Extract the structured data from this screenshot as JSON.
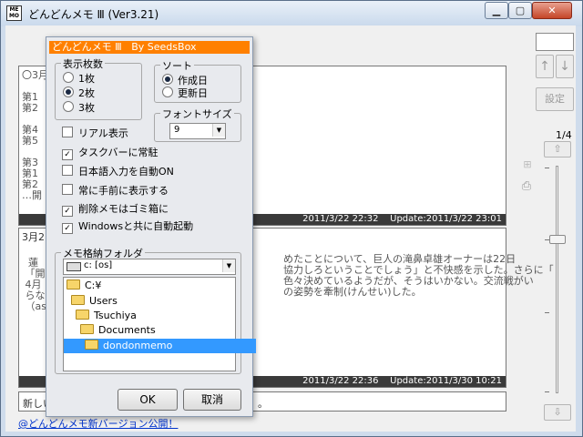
{
  "window": {
    "title": "どんどんメモ Ⅲ (Ver3.21)",
    "icon_text": "ME MO",
    "min_glyph": "▁",
    "max_glyph": "▢",
    "close_glyph": "✕"
  },
  "sidebar": {
    "up_glyph": "↑",
    "down_glyph": "↓",
    "settings_label": "設定",
    "page_indicator": "1/4",
    "page_up_glyph": "⇧",
    "page_down_glyph": "⇩",
    "tool1_glyph": "⊞",
    "tool2_glyph": "⎙"
  },
  "memos": [
    {
      "left_text": "〇3月\n\n第1\n第2\n\n第4\n第5\n\n第3\n第1\n第2\n…開",
      "footer": "2011/3/22 22:32    Update:2011/3/22 23:01"
    },
    {
      "date_text": "3月2",
      "left_text": "\n  蓮\n 「開\n 4月\n らな\n （asa",
      "body_text": "めたことについて、巨人の滝鼻卓雄オーナーは22日\n協力しろということでしょう」と不快感を示した。さらに「\n色々決めているようだが、そうはいかない。交流戦がい\nの姿勢を牽制(けんせい)した。",
      "footer": "2011/3/22 22:36    Update:2011/3/30 10:21"
    }
  ],
  "bottom_input": {
    "left_text": "新しい",
    "right_text": "。"
  },
  "status_link": "@どんどんメモ新バージョン公開！",
  "dialog": {
    "title": "どんどんメモ Ⅲ   By SeedsBox",
    "count_group": {
      "label": "表示枚数",
      "options": [
        "1枚",
        "2枚",
        "3枚"
      ],
      "selected": "2枚"
    },
    "sort_group": {
      "label": "ソート",
      "options": [
        "作成日",
        "更新日"
      ],
      "selected": "作成日"
    },
    "font_group": {
      "label": "フォントサイズ",
      "value": "9",
      "arrow": "▼"
    },
    "checkboxes": [
      {
        "label": "リアル表示",
        "checked": false
      },
      {
        "label": "タスクバーに常駐",
        "checked": true
      },
      {
        "label": "日本語入力を自動ON",
        "checked": false
      },
      {
        "label": "常に手前に表示する",
        "checked": false
      },
      {
        "label": "削除メモはゴミ箱に",
        "checked": true
      },
      {
        "label": "Windowsと共に自動起動",
        "checked": true
      }
    ],
    "folder_group": {
      "label": "メモ格納フォルダ",
      "drive": "c: [os]",
      "arrow": "▼",
      "folders": [
        {
          "name": "C:¥",
          "indent": 0,
          "selected": false
        },
        {
          "name": "Users",
          "indent": 1,
          "selected": false
        },
        {
          "name": "Tsuchiya",
          "indent": 2,
          "selected": false
        },
        {
          "name": "Documents",
          "indent": 3,
          "selected": false
        },
        {
          "name": "dondonmemo",
          "indent": 4,
          "selected": true
        }
      ]
    },
    "ok_label": "OK",
    "cancel_label": "取消"
  }
}
